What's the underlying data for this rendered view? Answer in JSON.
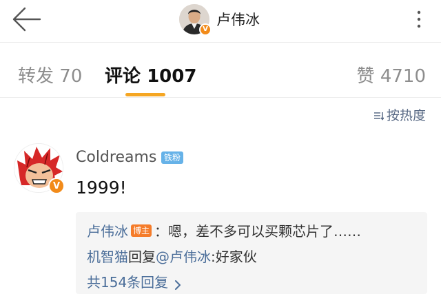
{
  "header": {
    "user_name": "卢伟冰",
    "verified_mark": "V"
  },
  "tabs": [
    {
      "label": "转发",
      "count": "70"
    },
    {
      "label": "评论",
      "count": "1007",
      "active": true
    },
    {
      "label": "赞",
      "count": "4710"
    }
  ],
  "sort": {
    "label": "按热度"
  },
  "comment": {
    "user": "Coldreams",
    "badge": "铁粉",
    "verified_mark": "V",
    "text": "1999!",
    "replies": [
      {
        "user": "卢伟冰",
        "badge": "博主",
        "text": "：嗯，差不多可以买颗芯片了……"
      },
      {
        "user": "机智猫",
        "verb": "回复",
        "mention": "@卢伟冰",
        "text": ":好家伙"
      }
    ],
    "more_replies": "共154条回复"
  },
  "colors": {
    "accent": "#f5a623",
    "link": "#4a6d99",
    "verified": "#f28b1a",
    "fan_badge": "#66b2e8",
    "blogger_badge": "#f57c2a"
  }
}
